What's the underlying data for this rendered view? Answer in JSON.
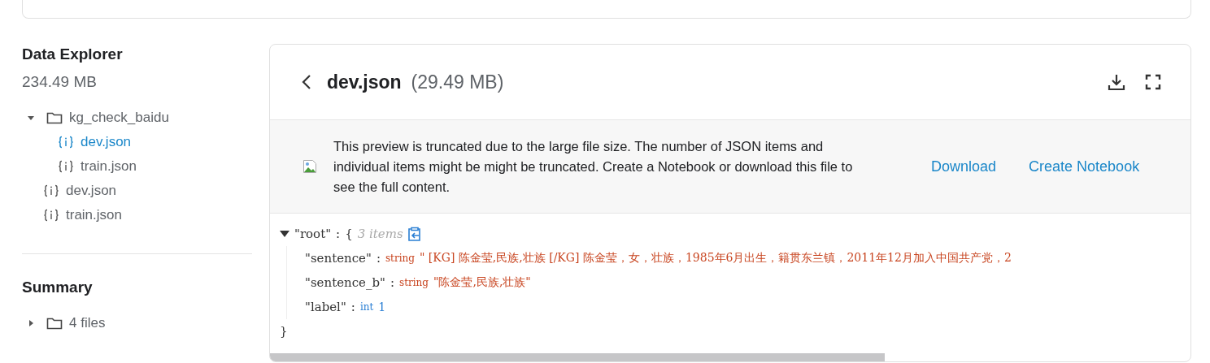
{
  "sidebar": {
    "title": "Data Explorer",
    "size": "234.49 MB",
    "tree": [
      {
        "name": "kg_check_baidu",
        "kind": "folder",
        "expanded": true,
        "children": [
          {
            "name": "dev.json",
            "kind": "json",
            "selected": true
          },
          {
            "name": "train.json",
            "kind": "json",
            "selected": false
          }
        ]
      },
      {
        "name": "dev.json",
        "kind": "json",
        "selected": false
      },
      {
        "name": "train.json",
        "kind": "json",
        "selected": false
      }
    ],
    "summary_title": "Summary",
    "summary": [
      {
        "name": "4 files",
        "kind": "folder",
        "expanded": false
      }
    ]
  },
  "file": {
    "name": "dev.json",
    "size": "(29.49 MB)"
  },
  "banner": {
    "message": "This preview is truncated due to the large file size. The number of JSON items and individual items might be might be truncated. Create a Notebook or download this file to see the full content.",
    "links": [
      "Download",
      "Create Notebook"
    ]
  },
  "json_view": {
    "root_key": "\"root\"",
    "separator": ":",
    "open_brace": "{",
    "count": "3 items",
    "expanded": true,
    "close_brace": "}",
    "entries": [
      {
        "key": "\"sentence\"",
        "type": "string",
        "value": "\" [KG] 陈金莹,民族,壮族 [/KG] 陈金莹，女，壮族，1985年6月出生，籍贯东兰镇，2011年12月加入中国共产党，2"
      },
      {
        "key": "\"sentence_b\"",
        "type": "string",
        "value": "\"陈金莹,民族,壮族\""
      },
      {
        "key": "\"label\"",
        "type": "int",
        "value": "1"
      }
    ]
  }
}
